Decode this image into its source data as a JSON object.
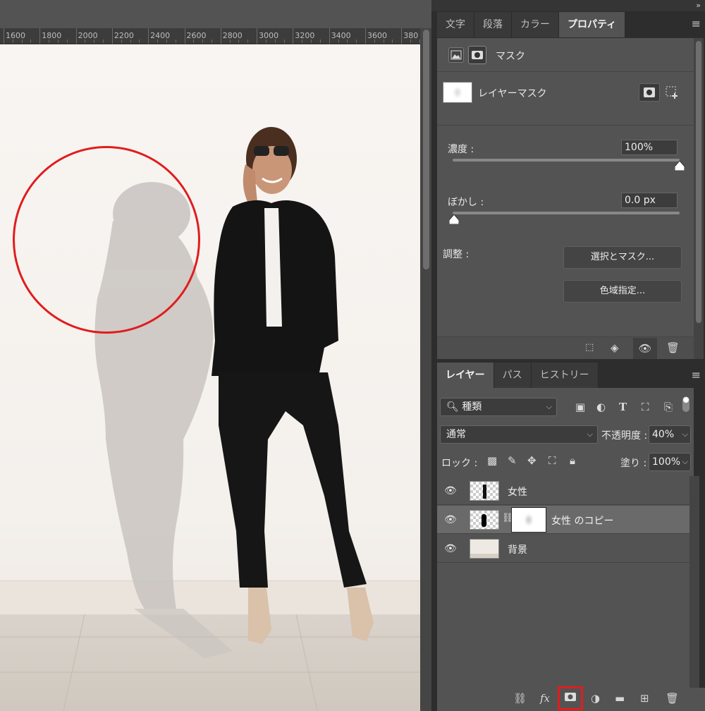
{
  "ruler": {
    "ticks": [
      "1600",
      "1800",
      "2000",
      "2200",
      "2400",
      "2600",
      "2800",
      "3000",
      "3200",
      "3400",
      "3600",
      "380"
    ]
  },
  "panel_top": {
    "collapse_glyph": "»"
  },
  "top_tabs": [
    {
      "label": "文字",
      "active": false
    },
    {
      "label": "段落",
      "active": false
    },
    {
      "label": "カラー",
      "active": false
    },
    {
      "label": "プロパティ",
      "active": true
    }
  ],
  "properties": {
    "header_label": "マスク",
    "mask_label": "レイヤーマスク",
    "density_label": "濃度 :",
    "density_value": "100%",
    "density_fraction": 1.0,
    "feather_label": "ぼかし :",
    "feather_value": "0.0 px",
    "feather_fraction": 0.0,
    "adjust_label": "調整 :",
    "select_mask_button": "選択とマスク...",
    "color_range_button": "色域指定..."
  },
  "layers_tabs": [
    {
      "label": "レイヤー",
      "active": true
    },
    {
      "label": "パス",
      "active": false
    },
    {
      "label": "ヒストリー",
      "active": false
    }
  ],
  "layers": {
    "filter_value": "種類",
    "blend_mode": "通常",
    "opacity_label": "不透明度 :",
    "opacity_value": "40%",
    "lock_label": "ロック :",
    "fill_label": "塗り :",
    "fill_value": "100%",
    "items": [
      {
        "name": "女性",
        "selected": false
      },
      {
        "name": "女性 のコピー",
        "selected": true
      },
      {
        "name": "背景",
        "selected": false
      }
    ]
  },
  "bottom_bar": {
    "fx_label": "fx"
  },
  "colors": {
    "highlight": "#e01d1d",
    "panel_bg": "#535353",
    "selected_row": "#6a6a6a"
  }
}
